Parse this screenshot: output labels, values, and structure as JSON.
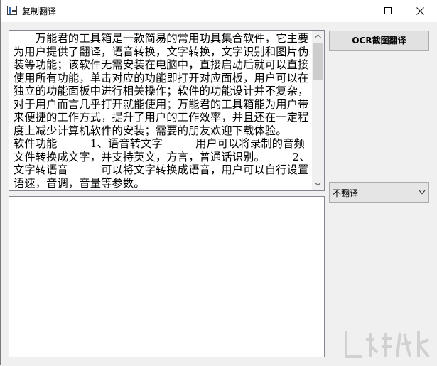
{
  "window": {
    "title": "复制翻译"
  },
  "text_area": {
    "content": "　　万能君的工具箱是一款简易的常用功具集合软件，它主要为用户提供了翻译，语音转换，文字转换，文字识别和图片伪装等功能；该软件无需安装在电脑中，直接启动后就可以直接使用所有功能，单击对应的功能即打开对应面板，用户可以在独立的功能面板中进行相关操作；软件的功能设计并不复杂，对于用户而言几乎打开就能使用；万能君的工具箱能为用户带来便捷的工作方式，提升了用户的工作效率，并且还在一定程度上减少计算机软件的安装；需要的朋友欢迎下载体验。\n软件功能　　　1、语音转文字　　　用户可以将录制的音频文件转换成文字，并支持英文，方言，普通话识别。　　　2、文字转语音　　　可以将文字转换成语音，用户可以自行设置语速，音调，音量等参数。"
  },
  "result_area": {
    "content": ""
  },
  "buttons": {
    "ocr": "OCR截图翻译"
  },
  "translate_select": {
    "value": "不翻译"
  },
  "colors": {
    "window_bg": "#f0f0f0",
    "button_bg": "#e1e1e1",
    "border": "#828790"
  },
  "icons": {
    "app": "app-window-icon",
    "minimize": "minimize-icon",
    "maximize": "maximize-icon",
    "close": "close-icon",
    "dropdown": "chevron-down-icon"
  }
}
